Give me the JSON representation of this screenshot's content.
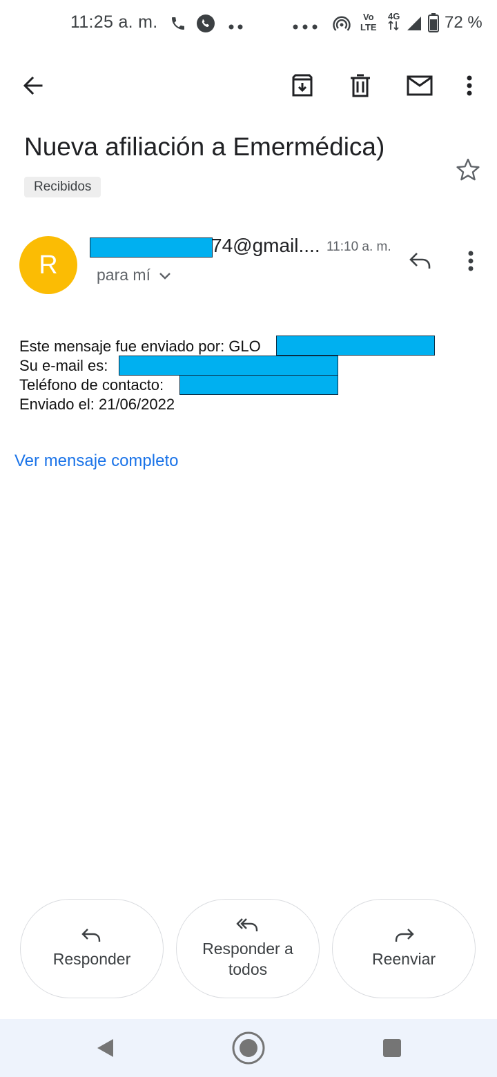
{
  "status_bar": {
    "time": "11:25 a. m.",
    "battery_percent": "72 %",
    "network_label": "4G",
    "volte_label_top": "Vo",
    "volte_label_bottom": "LTE"
  },
  "toolbar": {
    "back_icon": "arrow-left-icon",
    "archive_icon": "archive-icon",
    "delete_icon": "trash-icon",
    "mark_unread_icon": "mail-icon",
    "more_icon": "more-vert-icon"
  },
  "email": {
    "subject": "Nueva afiliación a Emermédica)",
    "label": "Recibidos",
    "avatar_letter": "R",
    "sender_visible": "74@gmail....",
    "time": "11:10 a. m.",
    "recipient": "para mí",
    "body_lines": [
      "Este mensaje fue enviado por: GLO",
      "Su e-mail es: ",
      "Teléfono de contacto:",
      "Enviado el: 21/06/2022"
    ],
    "view_full_link": "Ver mensaje completo"
  },
  "actions": {
    "reply": "Responder",
    "reply_all": "Responder a todos",
    "forward": "Reenviar"
  },
  "colors": {
    "avatar": "#fbbc04",
    "link": "#1a73e8",
    "redaction": "#00b0f0",
    "nav_bar": "#eef3fc"
  }
}
